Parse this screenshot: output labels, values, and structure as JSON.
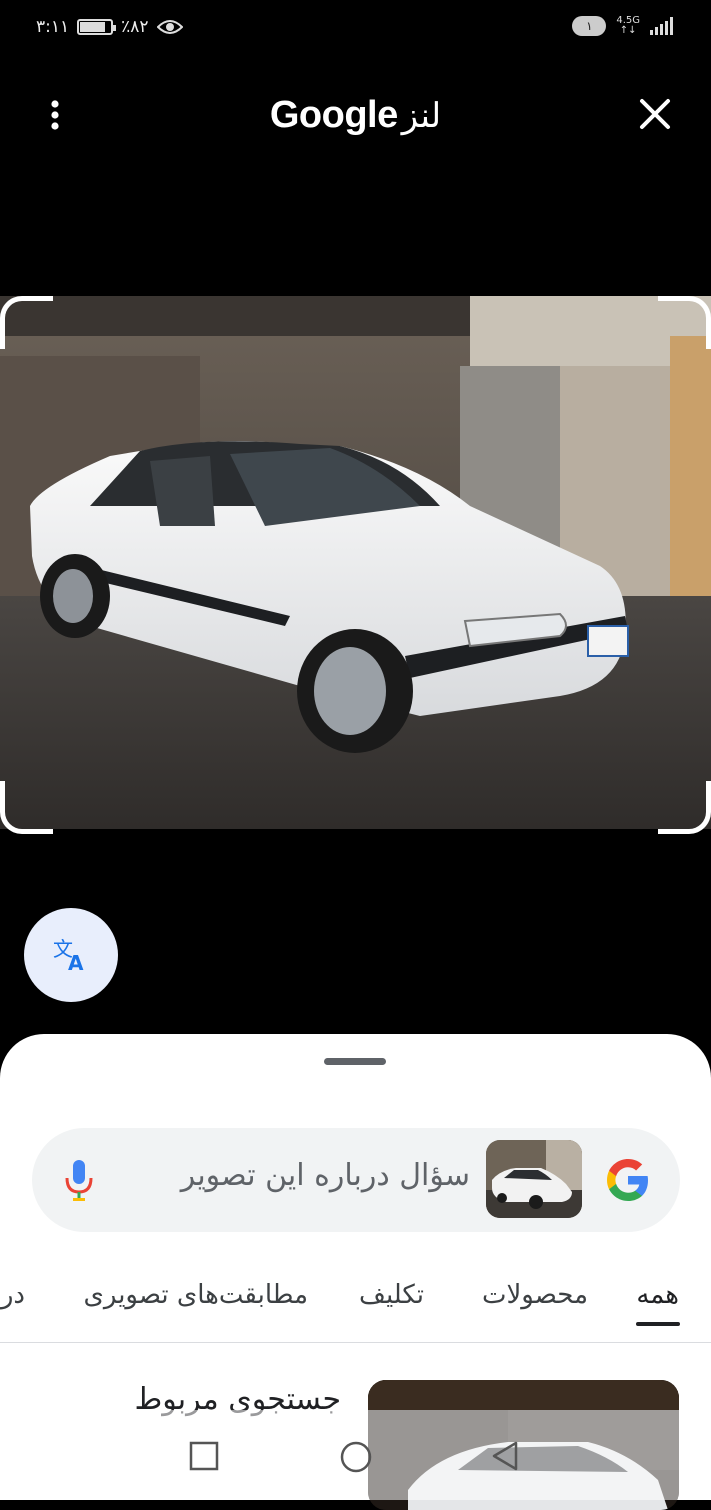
{
  "status_bar": {
    "time": "۳:۱۱",
    "battery_percent": "٪۸۲",
    "battery_level": 0.82,
    "notification_count": "۱",
    "network_top": "4.5G",
    "network_bottom": "↑↓"
  },
  "top_bar": {
    "title_logo": "Google",
    "title_suffix": "لنز",
    "menu_icon": "more-vert-icon",
    "close_icon": "close-icon"
  },
  "translate_button": {
    "icon": "translate-icon"
  },
  "search": {
    "placeholder": "سؤال درباره این تصویر",
    "mic_icon": "mic-icon",
    "logo_icon": "google-g-icon"
  },
  "tabs": [
    {
      "label": "همه",
      "active": true
    },
    {
      "label": "محصولات",
      "active": false
    },
    {
      "label": "تکلیف",
      "active": false
    },
    {
      "label": "مطابقت‌های تصویری",
      "active": false
    },
    {
      "label": "درب",
      "active": false
    }
  ],
  "results": {
    "heading": "جستجوی مربوط"
  },
  "nav_bar": {
    "square_icon": "recents-icon",
    "circle_icon": "home-icon",
    "triangle_icon": "back-icon"
  },
  "colors": {
    "background": "#000000",
    "sheet": "#ffffff",
    "search_box": "#f1f3f4",
    "translate_fab": "#e8eefc",
    "accent_blue": "#1a73e8"
  }
}
